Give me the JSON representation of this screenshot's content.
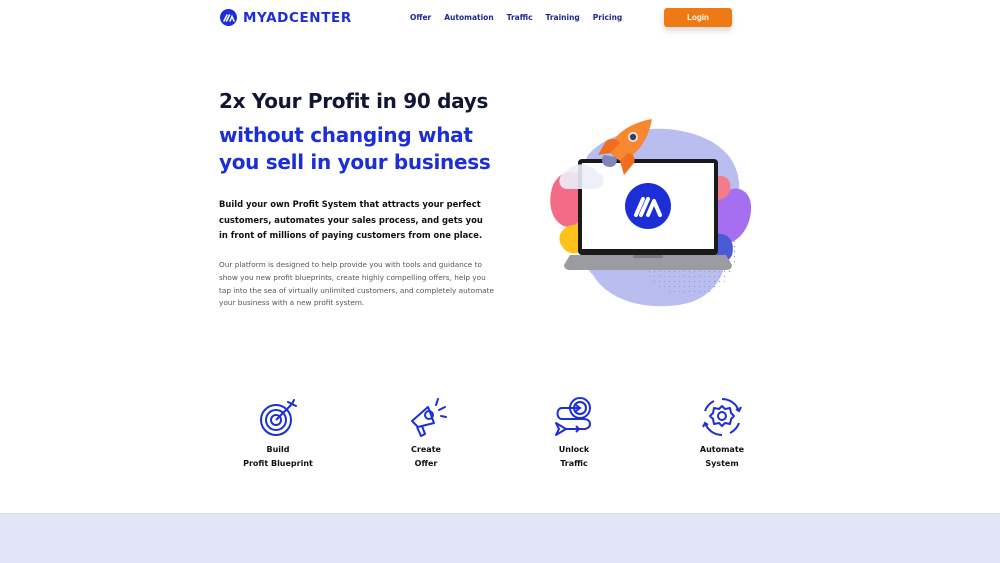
{
  "header": {
    "brand": "MYADCENTER",
    "nav": [
      "Offer",
      "Automation",
      "Traffic",
      "Training",
      "Pricing"
    ],
    "login_label": "Login"
  },
  "hero": {
    "title": "2x Your Profit in 90 days",
    "subtitle": "without changing what you sell in your business",
    "lead": "Build your own Profit System that attracts your perfect customers, automates your sales process, and gets you in front of millions of paying customers from one place.",
    "body": "Our platform is designed to help provide you with tools and guidance to show you new profit blueprints, create highly compelling offers, help you tap into the sea of virtually unlimited customers, and completely automate your business with a new profit system."
  },
  "features": [
    {
      "icon": "target-icon",
      "line1": "Build",
      "line2": "Profit Blueprint"
    },
    {
      "icon": "megaphone-icon",
      "line1": "Create",
      "line2": "Offer"
    },
    {
      "icon": "traffic-path-icon",
      "line1": "Unlock",
      "line2": "Traffic"
    },
    {
      "icon": "gear-cycle-icon",
      "line1": "Automate",
      "line2": "System"
    }
  ],
  "colors": {
    "brand_blue": "#1c2fd6",
    "accent_orange": "#ef7a14",
    "band": "#e2e4f8"
  }
}
